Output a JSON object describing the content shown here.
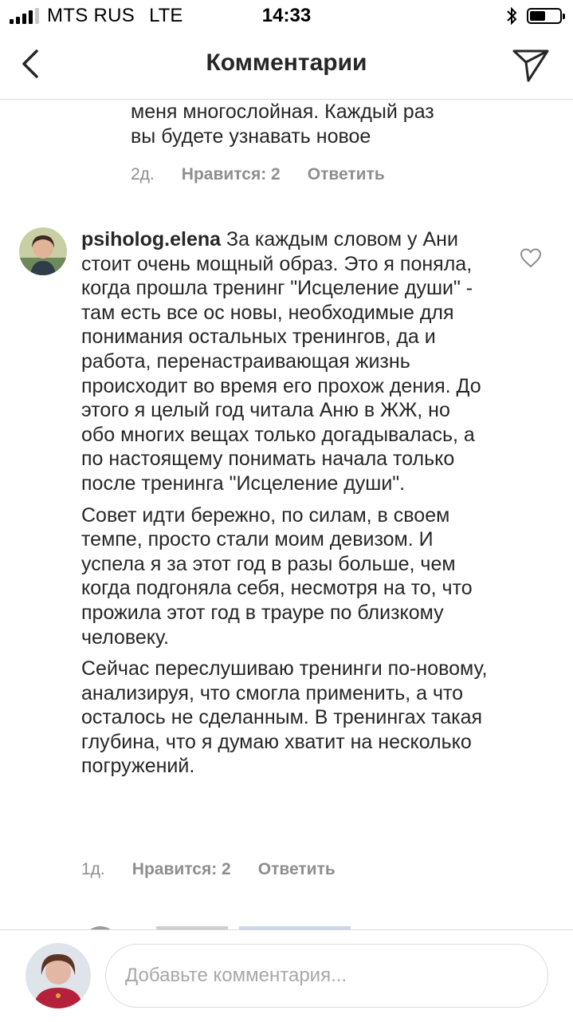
{
  "status_bar": {
    "carrier": "MTS RUS",
    "network": "LTE",
    "time": "14:33",
    "icons": [
      "signal-icon",
      "bluetooth-icon",
      "battery-icon"
    ],
    "battery_level": 0.55
  },
  "header": {
    "title": "Комментарии",
    "back_icon": "chevron-left-icon",
    "share_icon": "paper-plane-icon"
  },
  "previous_comment": {
    "text_lines": [
      "меня многослойная. Каждый раз",
      "вы будете узнавать новое"
    ],
    "age": "2д.",
    "likes": "Нравится: 2",
    "reply": "Ответить"
  },
  "comment": {
    "username": "psiholog.elena",
    "paragraphs": [
      "За каждым словом  у Ани стоит очень мощный образ. Это я поняла, когда прошла тренинг \"Исцеление души\" - там есть все ос новы, необходимые для понимания остальных тренингов, да и работа, перенастраивающая жизнь происходит во время его прохож дения. До этого я целый год читала Аню в ЖЖ, но обо многих вещах только догадывалась, а по настоящему понимать начала только после тренинга \"Исцеление души\".",
      "Совет идти бережно, по силам, в своем темпе, просто стали моим девизом. И успела я за этот год в разы больше, чем когда подгоняла себя, несмотря на то, что прожила этот год в трауре по близкому человеку.",
      "Сейчас переслушиваю тренинги по-новому, анализируя, что смогла применить, а что осталось не сделанным. В тренингах такая глубина, что я думаю хватит на несколько погружений."
    ],
    "age": "1д.",
    "likes": "Нравится: 2",
    "reply": "Ответить",
    "like_icon": "heart-outline-icon"
  },
  "composer": {
    "placeholder": "Добавьте комментария..."
  },
  "colors": {
    "text": "#262626",
    "secondary": "#8e8e8e",
    "divider": "#dbdbdb"
  }
}
